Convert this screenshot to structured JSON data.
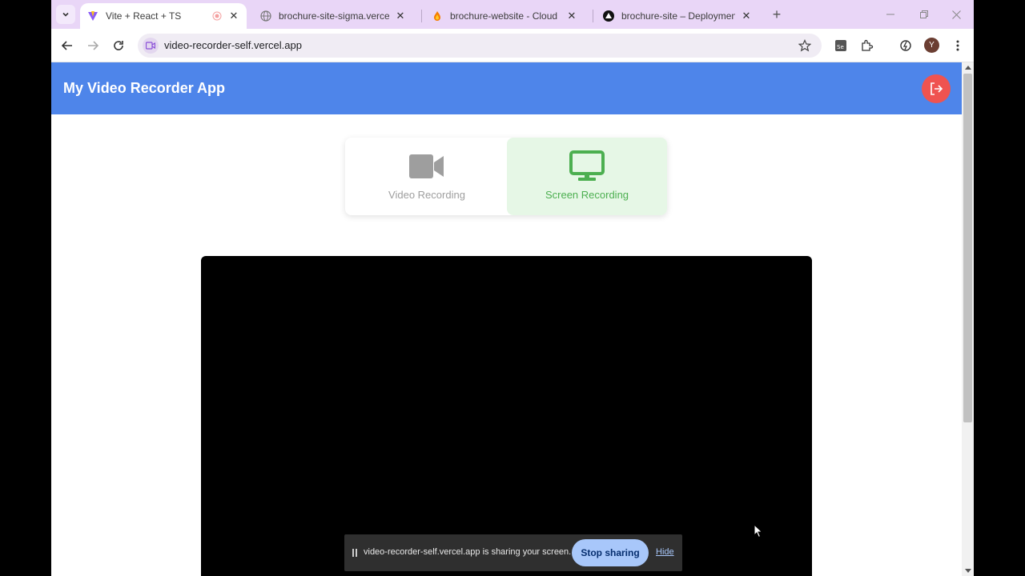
{
  "browser": {
    "tabs": [
      {
        "title": "Vite + React + TS",
        "active": true,
        "recording": true
      },
      {
        "title": "brochure-site-sigma.vercel.app",
        "active": false
      },
      {
        "title": "brochure-website - Cloud Firest",
        "active": false
      },
      {
        "title": "brochure-site – Deployment Ov",
        "active": false
      }
    ],
    "url": "video-recorder-self.vercel.app",
    "profile_initial": "Y",
    "accent_color": "#e9d6f7"
  },
  "app": {
    "title": "My Video Recorder App",
    "header_color": "#4e85ea",
    "logout_color": "#ef5350",
    "modes": [
      {
        "label": "Video Recording",
        "icon": "video-camera-icon",
        "selected": false
      },
      {
        "label": "Screen Recording",
        "icon": "monitor-icon",
        "selected": true
      }
    ],
    "selected_color": "#4caf50"
  },
  "share_bar": {
    "message": "video-recorder-self.vercel.app is sharing your screen.",
    "stop_label": "Stop sharing",
    "hide_label": "Hide"
  }
}
